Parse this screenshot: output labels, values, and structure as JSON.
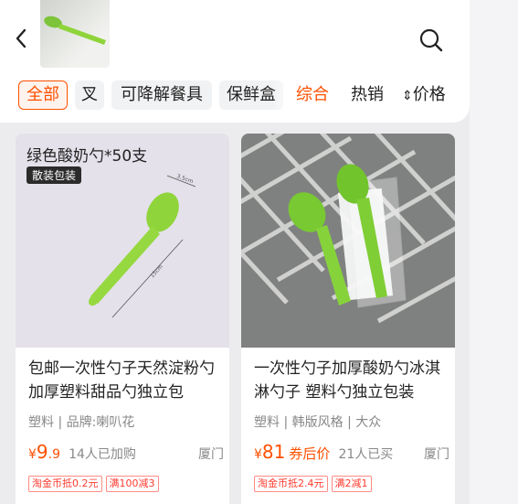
{
  "header": {
    "back_label": "",
    "thumb_label": ""
  },
  "filters": {
    "chips": [
      "全部",
      "叉",
      "可降解餐具",
      "保鲜盒"
    ],
    "sorts": [
      "综合",
      "热销",
      "价格"
    ],
    "sort_price_arrow": "⬍"
  },
  "products": [
    {
      "overlay_title": "绿色酸奶勺*50支",
      "overlay_badge": "散装包装",
      "title": "包邮一次性勺子天然淀粉勺加厚塑料甜品勺独立包",
      "tags": "塑料 | 品牌:喇叭花",
      "price_symbol": "¥",
      "price_int": "9",
      "price_dec": ".9",
      "coupon": "",
      "sold": "14人已加购",
      "location": "厦门",
      "promos": [
        "淘金币抵0.2元",
        "满100减3"
      ]
    },
    {
      "overlay_title": "",
      "overlay_badge": "",
      "title": "一次性勺子加厚酸奶勺冰淇淋勺子 塑料勺独立包装",
      "tags": "塑料 | 韩版风格 | 大众",
      "price_symbol": "¥",
      "price_int": "81",
      "price_dec": "",
      "coupon": "券后价",
      "sold": "21人已买",
      "location": "厦门",
      "promos": [
        "淘金币抵2.4元",
        "满2减1"
      ]
    }
  ],
  "colors": {
    "accent": "#ff5000",
    "spoon_green": "#8fd43a"
  },
  "icons": {
    "back": "chevron-left-icon",
    "search": "search-icon"
  }
}
